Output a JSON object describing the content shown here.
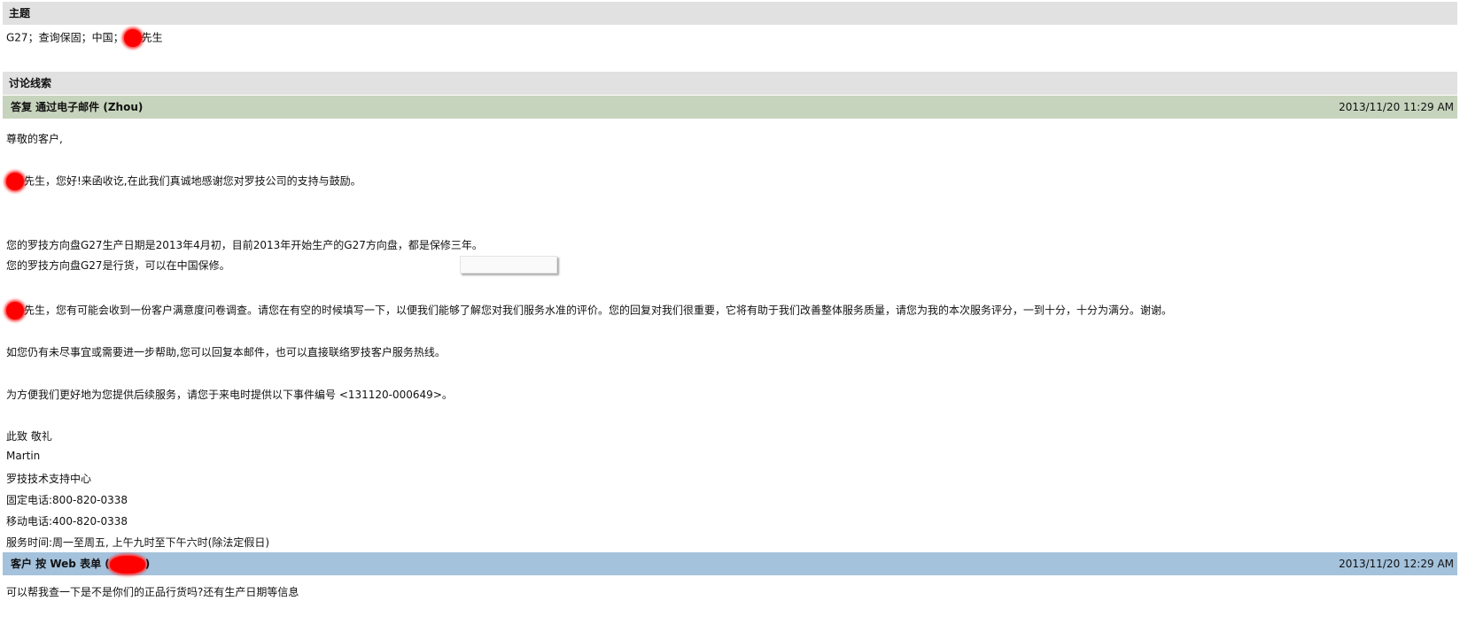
{
  "subject": {
    "header": "主题",
    "text_before": "G27；查询保固；中国；",
    "text_after": "先生"
  },
  "thread": {
    "header": "讨论线索",
    "reply": {
      "title": "答复 通过电子邮件 (Zhou)",
      "timestamp": "2013/11/20 11:29 AM",
      "lines": {
        "greeting": "尊敬的客户,",
        "hello": "先生，您好!来函收讫,在此我们真诚地感谢您对罗技公司的支持与鼓励。",
        "production": "您的罗技方向盘G27生产日期是2013年4月初，目前2013年开始生产的G27方向盘，都是保修三年。",
        "warranty": "您的罗技方向盘G27是行货，可以在中国保修。",
        "survey": "先生，您有可能会收到一份客户满意度问卷调查。请您在有空的时候填写一下，以便我们能够了解您对我们服务水准的评价。您的回复对我们很重要，它将有助于我们改善整体服务质量，请您为我的本次服务评分，一到十分，十分为满分。谢谢。",
        "followup": "如您仍有未尽事宜或需要进一步帮助,您可以回复本邮件，也可以直接联络罗技客户服务热线。",
        "incident": "为方便我们更好地为您提供后续服务，请您于来电时提供以下事件编号 <131120-000649>。",
        "regards": "此致 敬礼",
        "agent": "Martin",
        "center": "罗技技术支持中心",
        "landline": "固定电话:800-820-0338",
        "mobile": "移动电话:400-820-0338",
        "hours": "服务时间:周一至周五, 上午九时至下午六时(除法定假日)"
      }
    },
    "customer": {
      "title_before": "客户 按 Web 表单 (",
      "title_after": ")",
      "timestamp": "2013/11/20 12:29 AM",
      "message": "可以帮我查一下是不是你们的正品行货吗?还有生产日期等信息"
    }
  },
  "colors": {
    "gray_header": "#e1e1e1",
    "reply_header": "#c7d4bd",
    "customer_header": "#a4c2dc",
    "redaction": "#ff0000"
  }
}
